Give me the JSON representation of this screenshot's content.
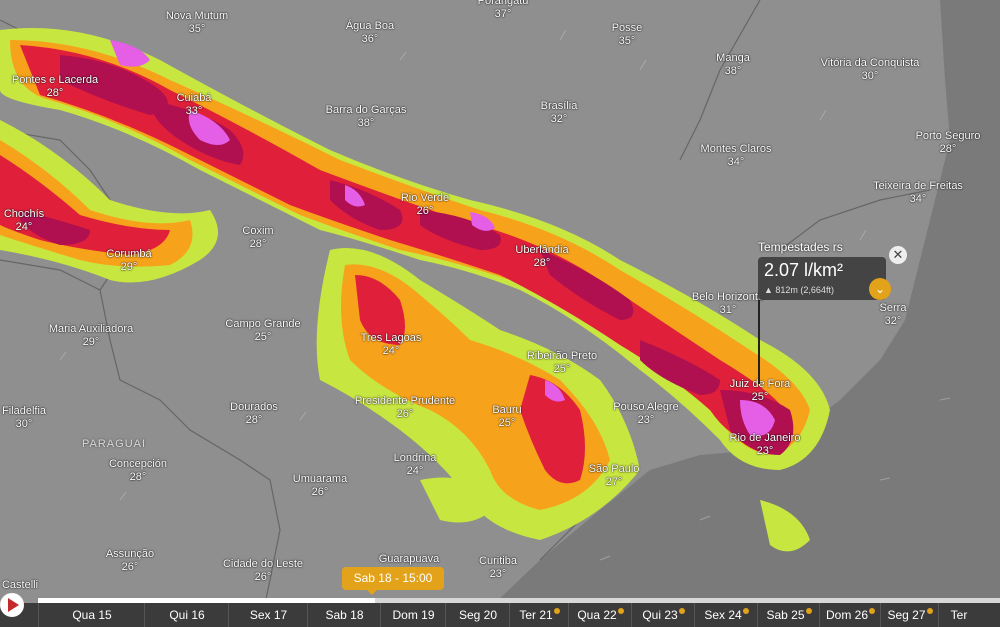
{
  "cities": [
    {
      "name": "Nova Mutum",
      "temp": "35°"
    },
    {
      "name": "Água Boa",
      "temp": "36°"
    },
    {
      "name": "Porangatu",
      "temp": "37°"
    },
    {
      "name": "Posse",
      "temp": "35°"
    },
    {
      "name": "Manga",
      "temp": "38°"
    },
    {
      "name": "Vitória da Conquista",
      "temp": "30°"
    },
    {
      "name": "Pontes e Lacerda",
      "temp": "28°"
    },
    {
      "name": "Cuiabá",
      "temp": "33°"
    },
    {
      "name": "Barra do Garças",
      "temp": "38°"
    },
    {
      "name": "Brasília",
      "temp": "32°"
    },
    {
      "name": "Montes Claros",
      "temp": "34°"
    },
    {
      "name": "Porto Seguro",
      "temp": "28°"
    },
    {
      "name": "Teixeira de Freitas",
      "temp": "34°"
    },
    {
      "name": "Chochís",
      "temp": "24°"
    },
    {
      "name": "Rio Verde",
      "temp": "26°"
    },
    {
      "name": "Coxim",
      "temp": "28°"
    },
    {
      "name": "Corumbá",
      "temp": "29°"
    },
    {
      "name": "Uberlândia",
      "temp": "28°"
    },
    {
      "name": "Belo Horizonte",
      "temp": "31°"
    },
    {
      "name": "Serra",
      "temp": "32°"
    },
    {
      "name": "Maria Auxiliadora",
      "temp": "29°"
    },
    {
      "name": "Campo Grande",
      "temp": "25°"
    },
    {
      "name": "Tres Lagoas",
      "temp": "24°"
    },
    {
      "name": "Ribeirão Preto",
      "temp": "25°"
    },
    {
      "name": "Juiz de Fora",
      "temp": "25°"
    },
    {
      "name": "Filadelfia",
      "temp": "30°"
    },
    {
      "name": "Dourados",
      "temp": "28°"
    },
    {
      "name": "Presidente Prudente",
      "temp": "26°"
    },
    {
      "name": "Bauru",
      "temp": "25°"
    },
    {
      "name": "Pouso Alegre",
      "temp": "23°"
    },
    {
      "name": "Rio de Janeiro",
      "temp": "23°"
    },
    {
      "name": "Concepción",
      "temp": "28°"
    },
    {
      "name": "Londrina",
      "temp": "24°"
    },
    {
      "name": "São Paulo",
      "temp": "27°"
    },
    {
      "name": "Umuarama",
      "temp": "26°"
    },
    {
      "name": "Assunção",
      "temp": "26°"
    },
    {
      "name": "Cidade do Leste",
      "temp": "26°"
    },
    {
      "name": "Guarapuava",
      "temp": ""
    },
    {
      "name": "Curitiba",
      "temp": "23°"
    },
    {
      "name": "Castelli",
      "temp": ""
    }
  ],
  "country_label": "PARAGUAI",
  "popup": {
    "title": "Tempestades rs",
    "value": "2.07 l/km²",
    "elevation": "▲ 812m (2,664ft)"
  },
  "timeline": {
    "current": "Sab 18 - 15:00",
    "progress": 0.35,
    "days": [
      {
        "label": "Qua 15",
        "premium": false
      },
      {
        "label": "Qui 16",
        "premium": false
      },
      {
        "label": "Sex 17",
        "premium": false
      },
      {
        "label": "Sab 18",
        "premium": false
      },
      {
        "label": "Dom 19",
        "premium": false
      },
      {
        "label": "Seg 20",
        "premium": false
      },
      {
        "label": "Ter 21",
        "premium": true
      },
      {
        "label": "Qua 22",
        "premium": true
      },
      {
        "label": "Qui 23",
        "premium": true
      },
      {
        "label": "Sex 24",
        "premium": true
      },
      {
        "label": "Sab 25",
        "premium": true
      },
      {
        "label": "Dom 26",
        "premium": true
      },
      {
        "label": "Seg 27",
        "premium": true
      },
      {
        "label": "Ter",
        "premium": false
      }
    ]
  },
  "colors": {
    "accent": "#e2a21a",
    "storm_low": "#c8e640",
    "storm_mid": "#f7a21b",
    "storm_high": "#e0203a",
    "storm_core": "#b0104f",
    "storm_peak": "#e45ee6"
  }
}
